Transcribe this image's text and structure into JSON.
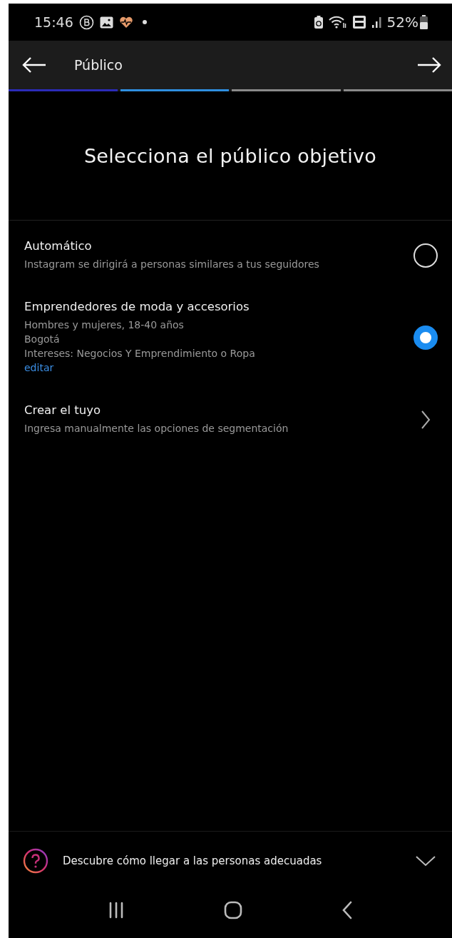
{
  "status_bar": {
    "time": "15:46",
    "battery": "52%"
  },
  "header": {
    "title": "Público"
  },
  "steps": [
    {
      "color": "#2b2bb8"
    },
    {
      "color": "#2f8fe0"
    },
    {
      "color": "#8a8a8a"
    },
    {
      "color": "#8a8a8a"
    }
  ],
  "heading": "Selecciona el público objetivo",
  "options": [
    {
      "kind": "radio",
      "title": "Automático",
      "details": [
        "Instagram se dirigirá a personas similares a tus seguidores"
      ],
      "selected": false
    },
    {
      "kind": "radio",
      "title": "Emprendedores de moda y accesorios",
      "details": [
        "Hombres y mujeres, 18-40 años",
        "Bogotá",
        "Intereses: Negocios Y Emprendimiento o Ropa"
      ],
      "link": "editar",
      "selected": true
    },
    {
      "kind": "chevron",
      "title": "Crear el tuyo",
      "details": [
        "Ingresa manualmente las opciones de segmentación"
      ]
    }
  ],
  "help": {
    "text": "Descubre cómo llegar a las personas adecuadas",
    "expanded": false
  }
}
